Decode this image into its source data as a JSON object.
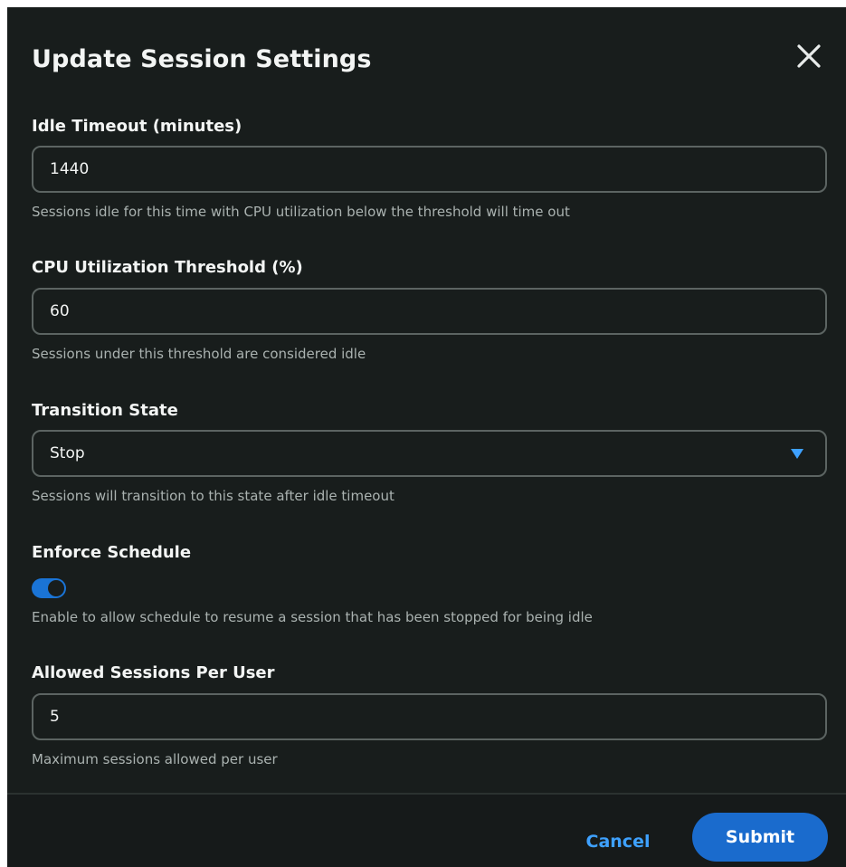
{
  "dialog": {
    "title": "Update Session Settings",
    "close_icon": "close-icon"
  },
  "fields": {
    "idle_timeout": {
      "label": "Idle Timeout (minutes)",
      "value": "1440",
      "help": "Sessions idle for this time with CPU utilization below the threshold will time out"
    },
    "cpu_threshold": {
      "label": "CPU Utilization Threshold (%)",
      "value": "60",
      "help": "Sessions under this threshold are considered idle"
    },
    "transition_state": {
      "label": "Transition State",
      "selected": "Stop",
      "help": "Sessions will transition to this state after idle timeout",
      "caret_icon": "caret-down-icon"
    },
    "enforce_schedule": {
      "label": "Enforce Schedule",
      "enabled": true,
      "help": "Enable to allow schedule to resume a session that has been stopped for being idle"
    },
    "allowed_sessions": {
      "label": "Allowed Sessions Per User",
      "value": "5",
      "help": "Maximum sessions allowed per user"
    }
  },
  "footer": {
    "cancel_label": "Cancel",
    "submit_label": "Submit"
  },
  "colors": {
    "background": "#181d1c",
    "accent": "#1a6bcd",
    "link": "#3ea1ff",
    "border": "#5c6462",
    "help_text": "#aab2b0"
  }
}
